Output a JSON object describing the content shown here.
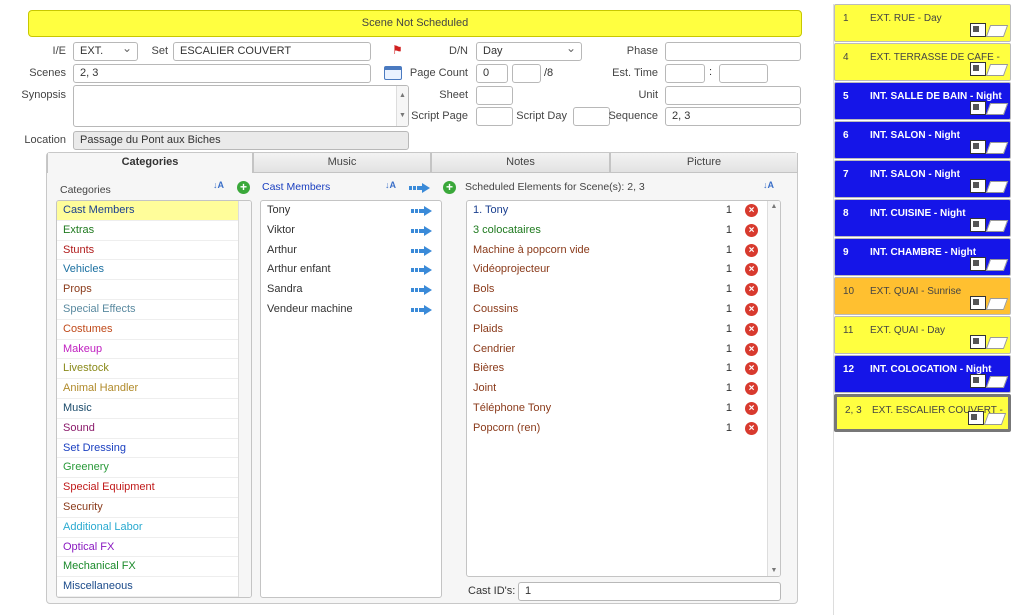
{
  "banner": "Scene Not Scheduled",
  "form": {
    "ie_label": "I/E",
    "ie_value": "EXT.",
    "set_label": "Set",
    "set_value": "ESCALIER COUVERT",
    "dn_label": "D/N",
    "dn_value": "Day",
    "phase_label": "Phase",
    "phase_value": "",
    "scenes_label": "Scenes",
    "scenes_value": "2, 3",
    "pagecount_label": "Page Count",
    "pagecount_value": "0",
    "pagecount_frac": "",
    "pagecount_den": "/8",
    "esttime_label": "Est. Time",
    "esttime_colon": ":",
    "synopsis_label": "Synopsis",
    "sheet_label": "Sheet",
    "unit_label": "Unit",
    "scriptpage_label": "Script Page",
    "scriptday_label": "Script Day",
    "sequence_label": "Sequence",
    "sequence_value": "2, 3",
    "location_label": "Location",
    "location_value": "Passage du Pont aux Biches"
  },
  "tabs": [
    "Categories",
    "Music",
    "Notes",
    "Picture"
  ],
  "categories": {
    "header": "Categories",
    "items": [
      {
        "label": "Cast Members",
        "color": "#1a3f8f"
      },
      {
        "label": "Extras",
        "color": "#1f7a1f"
      },
      {
        "label": "Stunts",
        "color": "#b01a1a"
      },
      {
        "label": "Vehicles",
        "color": "#1a6fa0"
      },
      {
        "label": "Props",
        "color": "#8a3a1a"
      },
      {
        "label": "Special Effects",
        "color": "#5a8aa0"
      },
      {
        "label": "Costumes",
        "color": "#c04a1a"
      },
      {
        "label": "Makeup",
        "color": "#c020c0"
      },
      {
        "label": "Livestock",
        "color": "#8a8a1a"
      },
      {
        "label": "Animal Handler",
        "color": "#b08a2a"
      },
      {
        "label": "Music",
        "color": "#1a4a6a"
      },
      {
        "label": "Sound",
        "color": "#8a1a6a"
      },
      {
        "label": "Set Dressing",
        "color": "#1a3fc0"
      },
      {
        "label": "Greenery",
        "color": "#2a9a3a"
      },
      {
        "label": "Special Equipment",
        "color": "#c01a1a"
      },
      {
        "label": "Security",
        "color": "#8a3a1a"
      },
      {
        "label": "Additional Labor",
        "color": "#2aaad0"
      },
      {
        "label": "Optical FX",
        "color": "#8a1ac0"
      },
      {
        "label": "Mechanical FX",
        "color": "#1a8a2a"
      },
      {
        "label": "Miscellaneous",
        "color": "#1a4a8a"
      }
    ]
  },
  "cast": {
    "header": "Cast Members",
    "items": [
      "Tony",
      "Viktor",
      "Arthur",
      "Arthur enfant",
      "Sandra",
      "Vendeur machine"
    ]
  },
  "scheduled": {
    "header": "Scheduled Elements for Scene(s): 2, 3",
    "items": [
      {
        "label": "1. Tony",
        "qty": "1",
        "color": "#1a3f8f"
      },
      {
        "label": "3 colocataires",
        "qty": "1",
        "color": "#1f7a1f"
      },
      {
        "label": "Machine à popcorn vide",
        "qty": "1",
        "color": "#8a3a1a"
      },
      {
        "label": "Vidéoprojecteur",
        "qty": "1",
        "color": "#8a3a1a"
      },
      {
        "label": "Bols",
        "qty": "1",
        "color": "#8a3a1a"
      },
      {
        "label": "Coussins",
        "qty": "1",
        "color": "#8a3a1a"
      },
      {
        "label": "Plaids",
        "qty": "1",
        "color": "#8a3a1a"
      },
      {
        "label": "Cendrier",
        "qty": "1",
        "color": "#8a3a1a"
      },
      {
        "label": "Bières",
        "qty": "1",
        "color": "#8a3a1a"
      },
      {
        "label": "Joint",
        "qty": "1",
        "color": "#8a3a1a"
      },
      {
        "label": "Téléphone Tony",
        "qty": "1",
        "color": "#8a3a1a"
      },
      {
        "label": "Popcorn (ren)",
        "qty": "1",
        "color": "#8a3a1a"
      }
    ]
  },
  "castids": {
    "label": "Cast ID's:",
    "value": "1"
  },
  "strips": [
    {
      "num": "1",
      "text": "EXT. RUE - Day",
      "type": "day"
    },
    {
      "num": "4",
      "text": "EXT. TERRASSE DE CAFE -",
      "type": "day"
    },
    {
      "num": "5",
      "text": "INT. SALLE DE BAIN - Night",
      "type": "night"
    },
    {
      "num": "6",
      "text": "INT. SALON - Night",
      "type": "night"
    },
    {
      "num": "7",
      "text": "INT. SALON - Night",
      "type": "night"
    },
    {
      "num": "8",
      "text": "INT. CUISINE - Night",
      "type": "night"
    },
    {
      "num": "9",
      "text": "INT. CHAMBRE - Night",
      "type": "night"
    },
    {
      "num": "10",
      "text": "EXT. QUAI - Sunrise",
      "type": "sunrise"
    },
    {
      "num": "11",
      "text": "EXT. QUAI - Day",
      "type": "day"
    },
    {
      "num": "12",
      "text": "INT. COLOCATION - Night",
      "type": "night"
    },
    {
      "num": "2, 3",
      "text": "EXT. ESCALIER COUVERT -",
      "type": "selected"
    }
  ],
  "colors": {
    "day": "#ffff40",
    "night": "#1515e8",
    "sunrise": "#ffc030",
    "selected": "#ffff40"
  }
}
